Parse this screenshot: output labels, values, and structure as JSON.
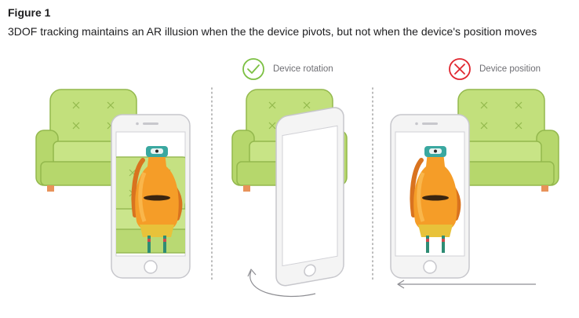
{
  "figure": {
    "label": "Figure 1",
    "caption": "3DOF tracking maintains an AR illusion when the the device pivots, but not when the device's position moves"
  },
  "panels": [
    {
      "id": "reference"
    },
    {
      "id": "rotation",
      "legend": "Device rotation",
      "status_icon": "checkmark-circle-icon",
      "status_color": "#7cc043"
    },
    {
      "id": "position",
      "legend": "Device position",
      "status_icon": "x-circle-icon",
      "status_color": "#e0262f"
    }
  ],
  "colors": {
    "chair_fill": "#bfe07a",
    "chair_stroke": "#8fb34a",
    "character_body": "#f5a623",
    "character_head": "#3aa8a0",
    "phone_frame": "#f2f2f2",
    "arrow": "#8e8e93"
  }
}
